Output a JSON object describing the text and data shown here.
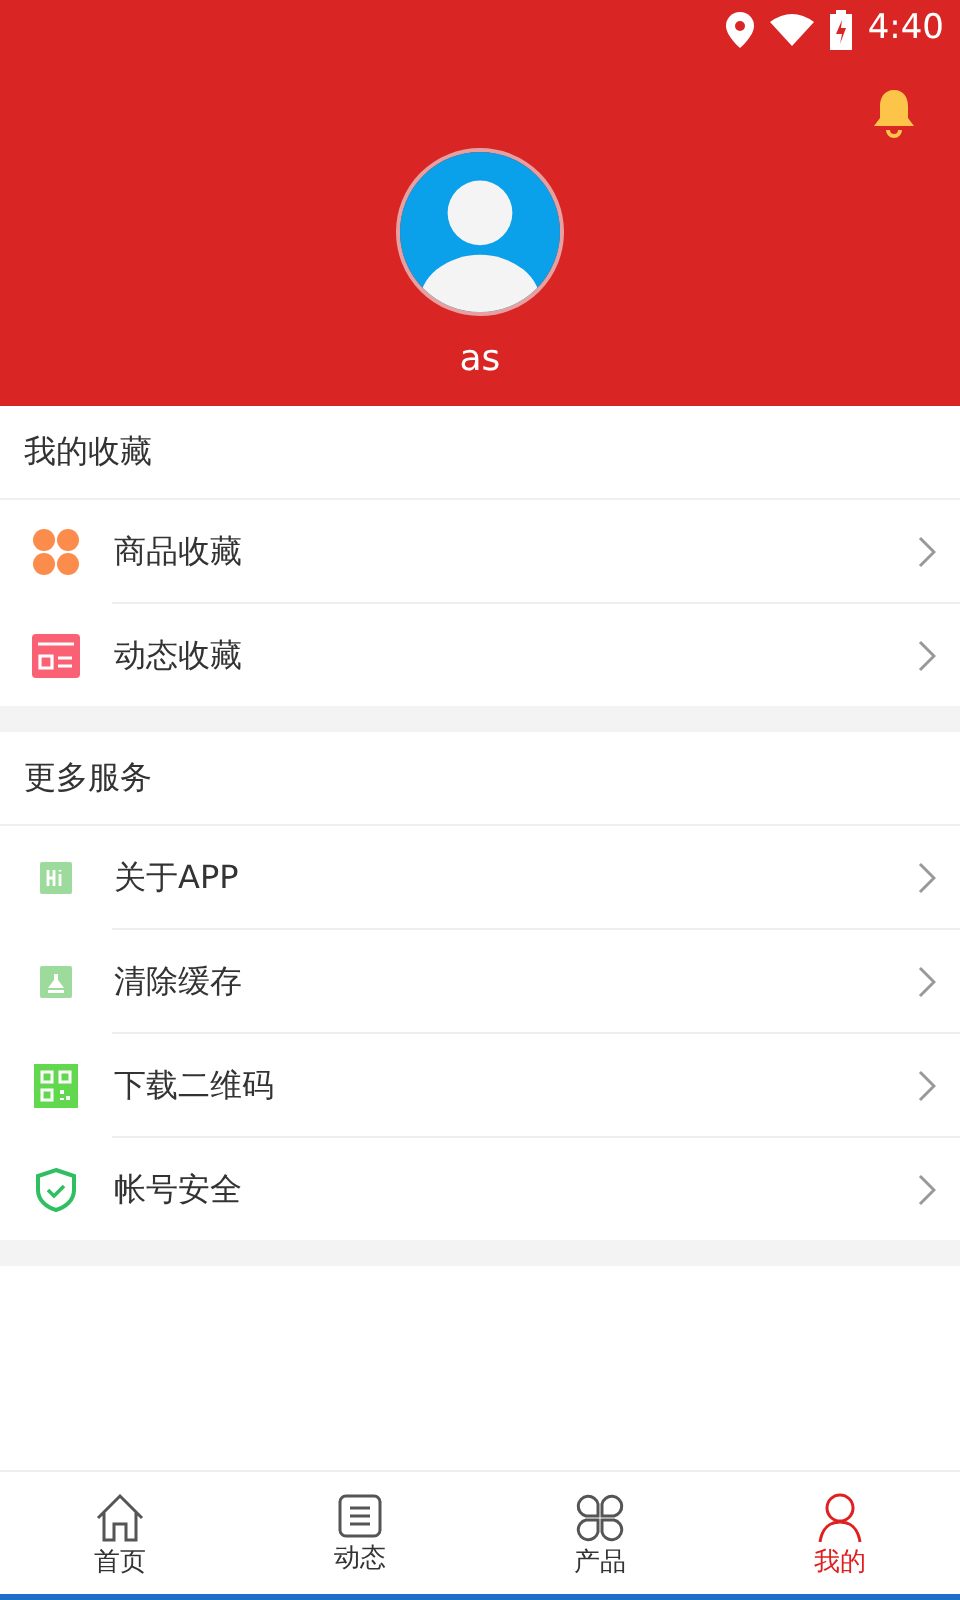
{
  "status_bar": {
    "time": "4:40"
  },
  "profile": {
    "username": "as"
  },
  "sections": [
    {
      "title": "我的收藏",
      "items": [
        {
          "label": "商品收藏",
          "kind": "clover"
        },
        {
          "label": "动态收藏",
          "kind": "news"
        }
      ]
    },
    {
      "title": "更多服务",
      "items": [
        {
          "label": "关于APP",
          "kind": "hi"
        },
        {
          "label": "清除缓存",
          "kind": "clean"
        },
        {
          "label": "下载二维码",
          "kind": "qr"
        },
        {
          "label": "帐号安全",
          "kind": "shield"
        }
      ]
    }
  ],
  "tabs": [
    {
      "label": "首页",
      "kind": "home",
      "selected": false
    },
    {
      "label": "动态",
      "kind": "list",
      "selected": false
    },
    {
      "label": "产品",
      "kind": "product",
      "selected": false
    },
    {
      "label": "我的",
      "kind": "user",
      "selected": true
    }
  ]
}
